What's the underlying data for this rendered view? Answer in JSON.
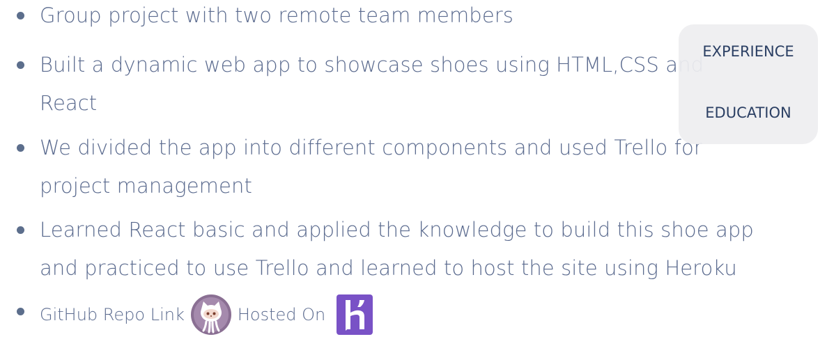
{
  "bullets": [
    {
      "lines": [
        "Group project with two remote team members"
      ]
    },
    {
      "lines": [
        "Built a dynamic web app to showcase shoes using HTML,CSS and",
        "React"
      ]
    },
    {
      "lines": [
        "We divided the app into different components and used Trello for",
        "project management"
      ]
    },
    {
      "lines": [
        "Learned React basic and applied the knowledge to build this shoe app",
        "and practiced to use Trello and learned to host the site using Heroku"
      ]
    }
  ],
  "links": {
    "github_label": "GitHub Repo Link",
    "hosted_label": "Hosted On"
  },
  "nav": {
    "experience": "EXPERIENCE",
    "education": "EDUCATION"
  },
  "icons": {
    "github": "github-octocat-icon",
    "heroku": "heroku-logo-icon"
  },
  "colors": {
    "text": "#5a6a8e",
    "nav_text": "#2b3f63",
    "github_bg": "#8a6f93",
    "heroku": "#7952c6"
  }
}
